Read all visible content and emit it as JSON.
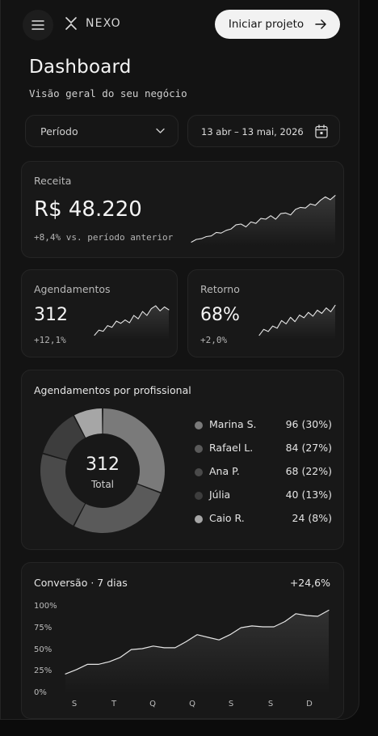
{
  "header": {
    "brand": "NEXO",
    "cta_label": "Iniciar projeto",
    "icons": {
      "menu": "hamburger-menu-icon",
      "logo": "nexo-logo-icon",
      "cta": "arrow-right-icon"
    }
  },
  "page": {
    "title": "Dashboard",
    "subtitle": "Visão geral do seu negócio"
  },
  "filters": {
    "period_label": "Período",
    "date_range": "13 abr – 13 mai, 2026",
    "icons": {
      "period": "chevron-down-icon",
      "date": "calendar-icon"
    }
  },
  "revenue": {
    "label": "Receita",
    "value": "R$ 48.220",
    "delta": "+8,4% vs. período anterior"
  },
  "appointments": {
    "label": "Agendamentos",
    "value": "312",
    "delta": "+12,1%"
  },
  "retention": {
    "label": "Retorno",
    "value": "68%",
    "delta": "+2,0%"
  },
  "by_professional": {
    "title": "Agendamentos por profissional",
    "total_value": "312",
    "total_label": "Total",
    "items": [
      {
        "name": "Marina S.",
        "value": "96 (30%)",
        "count": 96,
        "color": "#7a7a7a"
      },
      {
        "name": "Rafael L.",
        "value": "84 (27%)",
        "count": 84,
        "color": "#5a5a5a"
      },
      {
        "name": "Ana P.",
        "value": "68 (22%)",
        "count": 68,
        "color": "#4a4a4a"
      },
      {
        "name": "Júlia",
        "value": "40 (13%)",
        "count": 40,
        "color": "#3d3d3d"
      },
      {
        "name": "Caio R.",
        "value": "24 (8%)",
        "count": 24,
        "color": "#a6a6a6"
      }
    ]
  },
  "conversion": {
    "title": "Conversão · 7 dias",
    "delta": "+24,6%"
  },
  "chart_data": [
    {
      "type": "line",
      "name": "revenue-sparkline",
      "values": [
        3,
        7,
        8,
        11,
        12,
        17,
        16,
        20,
        22,
        28,
        29,
        25,
        32,
        30,
        37,
        36,
        41,
        36,
        44,
        45,
        42,
        50,
        53,
        52,
        58,
        56,
        63,
        68,
        64,
        70
      ]
    },
    {
      "type": "line",
      "name": "appointments-sparkline",
      "values": [
        5,
        14,
        12,
        22,
        19,
        30,
        26,
        32,
        27,
        40,
        34,
        47,
        40,
        52,
        57,
        48,
        55,
        50
      ]
    },
    {
      "type": "line",
      "name": "retention-sparkline",
      "values": [
        5,
        16,
        12,
        22,
        18,
        32,
        26,
        38,
        30,
        42,
        37,
        47,
        40,
        51,
        45,
        55,
        48,
        60
      ]
    },
    {
      "type": "pie",
      "name": "appointments-by-professional",
      "labels": [
        "Marina S.",
        "Rafael L.",
        "Ana P.",
        "Júlia",
        "Caio R."
      ],
      "values": [
        96,
        84,
        68,
        40,
        24
      ]
    },
    {
      "type": "area",
      "name": "conversion-7-days",
      "x": [
        "S",
        "T",
        "Q",
        "Q",
        "S",
        "S",
        "D"
      ],
      "ylim": [
        0,
        100
      ],
      "yticks": [
        "100%",
        "75%",
        "50%",
        "25%",
        "0%"
      ],
      "values": [
        21,
        26,
        32,
        32,
        35,
        40,
        49,
        50,
        53,
        51,
        51,
        58,
        66,
        63,
        60,
        66,
        74,
        76,
        75,
        75,
        81,
        90,
        88,
        87,
        94
      ]
    }
  ]
}
